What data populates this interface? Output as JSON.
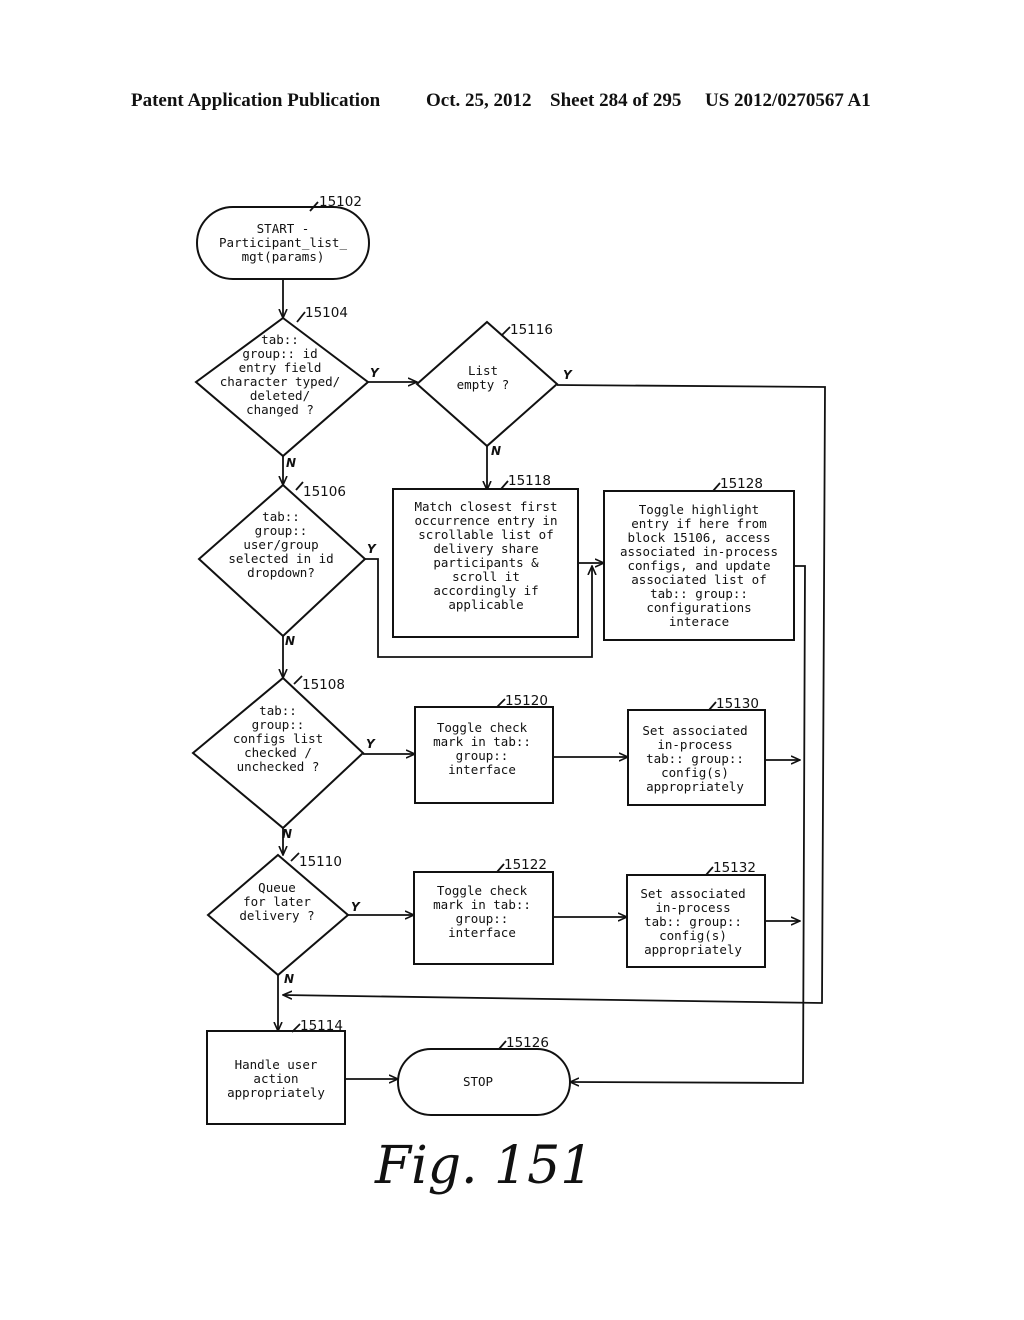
{
  "header": {
    "publication": "Patent Application Publication",
    "date": "Oct. 25, 2012",
    "sheet": "Sheet 284 of 295",
    "number": "US 2012/0270567 A1"
  },
  "figure_label": "Fig. 151",
  "branch_labels": {
    "yes": "Y",
    "no": "N"
  },
  "nodes": {
    "n15102": {
      "ref": "15102",
      "type": "terminal",
      "lines": [
        "START -",
        "Participant_list_",
        "mgt(params)"
      ]
    },
    "n15104": {
      "ref": "15104",
      "type": "decision",
      "lines": [
        "tab::",
        "group:: id",
        "entry field",
        "character typed/",
        "deleted/",
        "changed ?"
      ]
    },
    "n15116": {
      "ref": "15116",
      "type": "decision",
      "lines": [
        "List",
        "empty ?"
      ]
    },
    "n15118": {
      "ref": "15118",
      "type": "process",
      "lines": [
        "Match closest first",
        "occurrence entry in",
        "scrollable list of",
        "delivery share",
        "participants &",
        "scroll it",
        "accordingly if",
        "applicable"
      ]
    },
    "n15128": {
      "ref": "15128",
      "type": "process",
      "lines": [
        "Toggle highlight",
        "entry if here from",
        "block 15106, access",
        "associated in-process",
        "configs, and update",
        "associated list of",
        "tab:: group::",
        "configurations",
        "interace"
      ]
    },
    "n15106": {
      "ref": "15106",
      "type": "decision",
      "lines": [
        "tab::",
        "group::",
        "user/group",
        "selected in id",
        "dropdown?"
      ]
    },
    "n15108": {
      "ref": "15108",
      "type": "decision",
      "lines": [
        "tab::",
        "group::",
        "configs list",
        "checked /",
        "unchecked ?"
      ]
    },
    "n15120": {
      "ref": "15120",
      "type": "process",
      "lines": [
        "Toggle check",
        "mark in tab::",
        "group::",
        "interface"
      ]
    },
    "n15130": {
      "ref": "15130",
      "type": "process",
      "lines": [
        "Set associated",
        "in-process",
        "tab:: group::",
        "config(s)",
        "appropriately"
      ]
    },
    "n15110": {
      "ref": "15110",
      "type": "decision",
      "lines": [
        "Queue",
        "for later",
        "delivery ?"
      ]
    },
    "n15122": {
      "ref": "15122",
      "type": "process",
      "lines": [
        "Toggle check",
        "mark in tab::",
        "group::",
        "interface"
      ]
    },
    "n15132": {
      "ref": "15132",
      "type": "process",
      "lines": [
        "Set associated",
        "in-process",
        "tab:: group::",
        "config(s)",
        "appropriately"
      ]
    },
    "n15114": {
      "ref": "15114",
      "type": "process",
      "lines": [
        "Handle user",
        "action",
        "appropriately"
      ]
    },
    "n15126": {
      "ref": "15126",
      "type": "terminal",
      "lines": [
        "STOP"
      ]
    }
  }
}
